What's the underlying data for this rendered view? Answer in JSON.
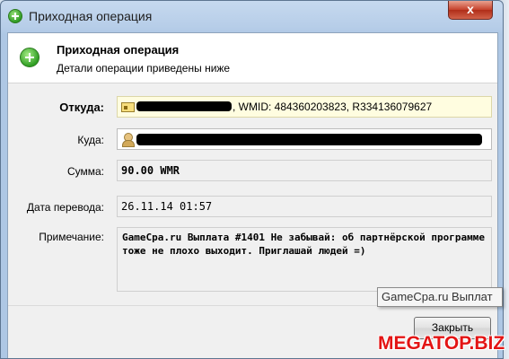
{
  "window": {
    "title": "Приходная операция",
    "close_label": "x"
  },
  "header": {
    "title": "Приходная операция",
    "subtitle": "Детали операции приведены ниже"
  },
  "form": {
    "from_label": "Откуда:",
    "from_value": ", WMID: 484360203823, R334136079627",
    "to_label": "Куда:",
    "to_value": "",
    "amount_label": "Сумма:",
    "amount_value": "90.00 WMR",
    "date_label": "Дата перевода:",
    "date_value": "26.11.14 01:57",
    "note_label": "Примечание:",
    "note_value": "GameCpa.ru Выплата #1401 Не забывай: об партнёрской программе тоже не плохо выходит. Приглашай людей =)"
  },
  "tooltip": {
    "text": "GameCpa.ru Выплат"
  },
  "buttons": {
    "close_label": "Закрыть"
  },
  "watermark": {
    "text": "MEGATOP.BIZ"
  },
  "colors": {
    "accent_green": "#2e9a23",
    "field_yellow": "#fffde0",
    "watermark_red": "#e31414"
  }
}
